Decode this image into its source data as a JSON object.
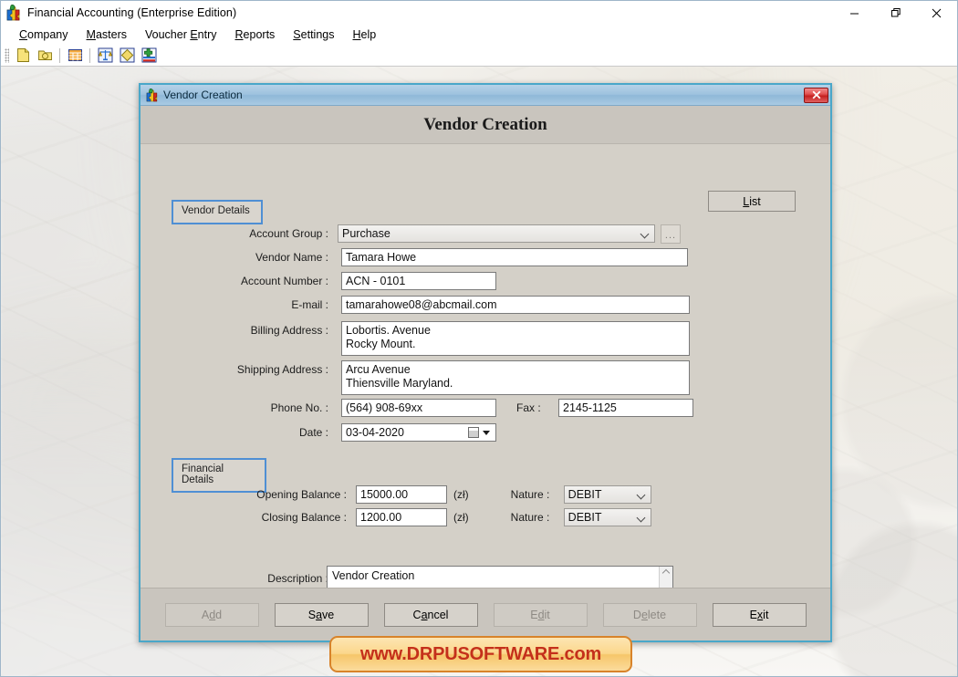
{
  "app": {
    "title": "Financial Accounting (Enterprise Edition)",
    "icon": "app-puzzle-icon",
    "window_controls": {
      "minimize": "─",
      "maximize": "❐",
      "close": "✕"
    }
  },
  "menubar": {
    "items": [
      {
        "label": "Company",
        "mnemonic": "C",
        "rest": "ompany"
      },
      {
        "label": "Masters",
        "mnemonic": "M",
        "rest": "asters"
      },
      {
        "label": "Voucher Entry",
        "prefix": "Voucher ",
        "mnemonic": "E",
        "rest": "ntry"
      },
      {
        "label": "Reports",
        "mnemonic": "R",
        "rest": "eports"
      },
      {
        "label": "Settings",
        "mnemonic": "S",
        "rest": "ettings"
      },
      {
        "label": "Help",
        "mnemonic": "H",
        "rest": "elp"
      }
    ]
  },
  "toolbar": {
    "buttons": [
      {
        "name": "new-company-icon",
        "tooltip": "New Company"
      },
      {
        "name": "open-company-icon",
        "tooltip": "Open Company"
      },
      {
        "name": "ledger-icon",
        "tooltip": "Ledger"
      },
      {
        "name": "trial-balance-icon",
        "tooltip": "Trial Balance"
      },
      {
        "name": "voucher-icon",
        "tooltip": "Voucher"
      },
      {
        "name": "add-entry-icon",
        "tooltip": "Add Entry"
      }
    ]
  },
  "dialog": {
    "titlebar_text": "Vendor Creation",
    "titlebar_icon": "app-puzzle-icon",
    "close_label": "x",
    "header_title": "Vendor Creation",
    "list_button": {
      "label": "List",
      "mnemonic": "L",
      "rest": "ist"
    },
    "sections": {
      "vendor_details": {
        "tab_label": "Vendor Details",
        "fields": [
          {
            "name": "account-group",
            "label": "Account Group :",
            "value": "Purchase",
            "control": "combo"
          },
          {
            "name": "vendor-name",
            "label": "Vendor Name :",
            "value": "Tamara Howe",
            "control": "text"
          },
          {
            "name": "account-number",
            "label": "Account Number :",
            "value": "ACN - 0101",
            "control": "text"
          },
          {
            "name": "email",
            "label": "E-mail :",
            "value": "tamarahowe08@abcmail.com",
            "control": "text"
          },
          {
            "name": "billing-address",
            "label": "Billing Address :",
            "value": "Lobortis. Avenue\nRocky Mount.",
            "control": "textarea"
          },
          {
            "name": "shipping-address",
            "label": "Shipping Address :",
            "value": "Arcu Avenue\nThiensville Maryland.",
            "control": "textarea"
          },
          {
            "name": "phone-no",
            "label": "Phone No. :",
            "value": "(564) 908-69xx",
            "control": "text"
          },
          {
            "name": "fax",
            "label": "Fax :",
            "value": "2145-1125",
            "control": "text"
          },
          {
            "name": "date",
            "label": "Date :",
            "value": "03-04-2020",
            "control": "datepicker"
          }
        ]
      },
      "financial_details": {
        "tab_label": "Financial Details",
        "currency_unit": "(zł)",
        "nature_label": "Nature :",
        "rows": [
          {
            "name": "opening-balance",
            "label": "Opening Balance :",
            "value": "15000.00",
            "unit": "(zł)",
            "nature": "DEBIT"
          },
          {
            "name": "closing-balance",
            "label": "Closing Balance :",
            "value": "1200.00",
            "unit": "(zł)",
            "nature": "DEBIT"
          }
        ]
      },
      "description": {
        "label": "Description :",
        "value": "Vendor Creation"
      }
    },
    "footer_buttons": [
      {
        "name": "add-button",
        "label": "Add",
        "prefix": "A",
        "mnemonic": "d",
        "rest": "d",
        "disabled": true
      },
      {
        "name": "save-button",
        "label": "Save",
        "prefix": "S",
        "mnemonic": "a",
        "rest": "ve",
        "disabled": false
      },
      {
        "name": "cancel-button",
        "label": "Cancel",
        "prefix": "C",
        "mnemonic": "a",
        "rest": "ncel",
        "disabled": false
      },
      {
        "name": "edit-button",
        "label": "Edit",
        "prefix": "E",
        "mnemonic": "d",
        "rest": "it",
        "disabled": true
      },
      {
        "name": "delete-button",
        "label": "Delete",
        "prefix": "D",
        "mnemonic": "e",
        "rest": "lete",
        "disabled": true
      },
      {
        "name": "exit-button",
        "label": "Exit",
        "prefix": "E",
        "mnemonic": "x",
        "rest": "it",
        "disabled": false
      }
    ]
  },
  "watermark": {
    "text": "www.DRPUSOFTWARE.com"
  },
  "colors": {
    "dialog_border": "#4aa7c9",
    "dialog_face": "#d4d0c8",
    "tab_outline": "#4f8fd4",
    "close_red": "#c52020",
    "watermark_text": "#c4301b",
    "watermark_bg": "#fbd78c",
    "watermark_border": "#d8832a"
  }
}
